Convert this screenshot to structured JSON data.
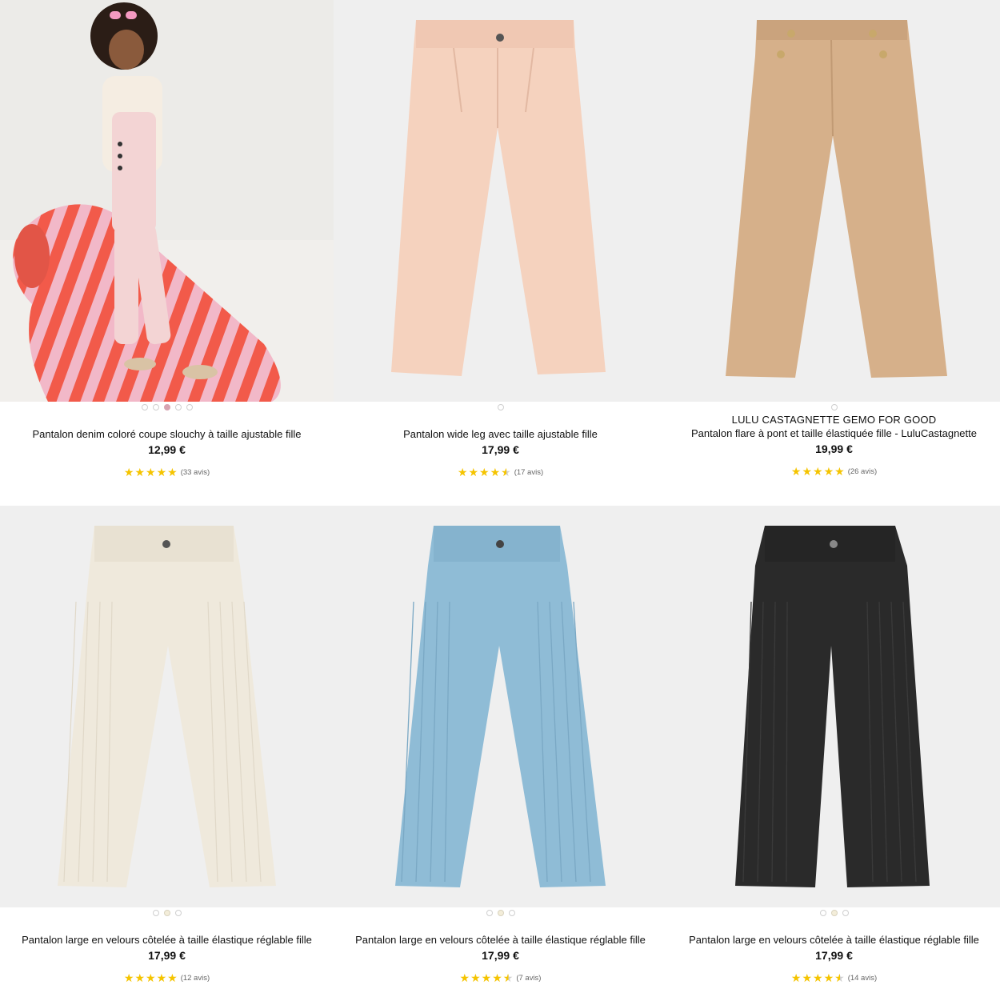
{
  "products": [
    {
      "title": "Pantalon denim coloré coupe slouchy à taille ajustable fille",
      "price": "12,99 €",
      "reviews": "(33 avis)",
      "rating": 5,
      "image": "model-photo-pink-trousers",
      "dots": 5,
      "active_dot": 3
    },
    {
      "title": "Pantalon wide leg avec taille ajustable fille",
      "price": "17,99 €",
      "reviews": "(17 avis)",
      "rating": 4.5,
      "image": "pink-wide-leg-trousers",
      "dots": 1,
      "active_dot": 0
    },
    {
      "brand": "LULU CASTAGNETTE GEMO FOR GOOD",
      "title": "Pantalon flare à pont et taille élastiquée fille - LuluCastagnette",
      "price": "19,99 €",
      "reviews": "(26 avis)",
      "rating": 5,
      "image": "camel-flare-trousers",
      "dots": 1,
      "active_dot": 0
    },
    {
      "title": "Pantalon large en velours côtelée à taille élastique réglable fille",
      "price": "17,99 €",
      "reviews": "(12 avis)",
      "rating": 5,
      "image": "cream-corduroy-trousers",
      "dots": 3,
      "active_dot": 1
    },
    {
      "title": "Pantalon large en velours côtelée à taille élastique réglable fille",
      "price": "17,99 €",
      "reviews": "(7 avis)",
      "rating": 4.5,
      "image": "blue-corduroy-trousers",
      "dots": 3,
      "active_dot": 1
    },
    {
      "title": "Pantalon large en velours côtelée à taille élastique réglable fille",
      "price": "17,99 €",
      "reviews": "(14 avis)",
      "rating": 4.5,
      "image": "black-corduroy-trousers",
      "dots": 3,
      "active_dot": 1
    }
  ],
  "colors": {
    "star": "#f5c400",
    "pink_trousers": "#f5d2be",
    "camel_trousers": "#d6b08a",
    "cream_trousers": "#efe9dc",
    "blue_trousers": "#8fbcd6",
    "black_trousers": "#2a2a2a"
  }
}
